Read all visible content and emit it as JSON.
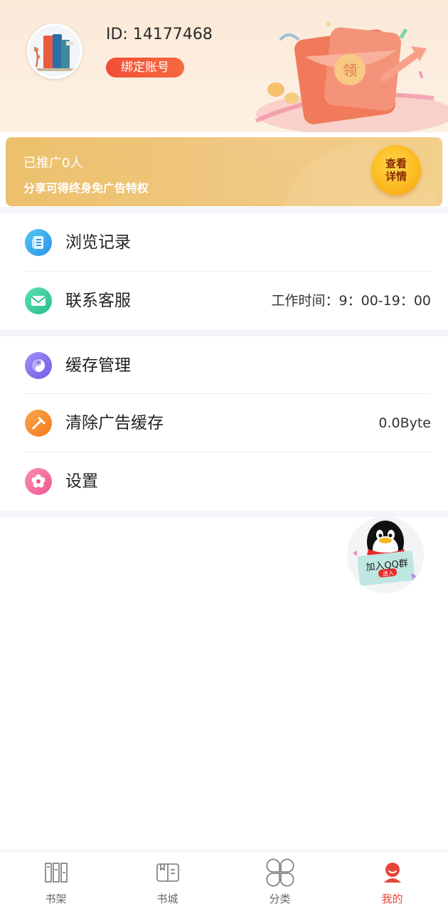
{
  "profile": {
    "user_id": "ID: 14177468",
    "bind_label": "绑定账号"
  },
  "promo": {
    "count_text": "已推广0人",
    "tip_text": "分享可得终身免广告特权",
    "detail_label": "查看详情",
    "hongbao_glyph": "领"
  },
  "menu": {
    "history": {
      "label": "浏览记录",
      "icon": "browse-history-icon"
    },
    "service": {
      "label": "联系客服",
      "right": "工作时间：9：00-19：00",
      "icon": "mail-icon"
    },
    "cache": {
      "label": "缓存管理",
      "icon": "yin-yang-icon"
    },
    "clear_ad": {
      "label": "清除广告缓存",
      "right": "0.0Byte",
      "icon": "broom-icon"
    },
    "settings": {
      "label": "设置",
      "icon": "flower-icon"
    }
  },
  "qq": {
    "label": "加入QQ群",
    "enter": "进入"
  },
  "tabs": [
    {
      "label": "书架",
      "icon": "bookshelf-icon",
      "active": false
    },
    {
      "label": "书城",
      "icon": "open-book-icon",
      "active": false
    },
    {
      "label": "分类",
      "icon": "category-icon",
      "active": false
    },
    {
      "label": "我的",
      "icon": "profile-icon",
      "active": true
    }
  ],
  "colors": {
    "accent": "#e8463a",
    "promo_bg": "#ecc06b",
    "bind_button": "#f24d35"
  }
}
